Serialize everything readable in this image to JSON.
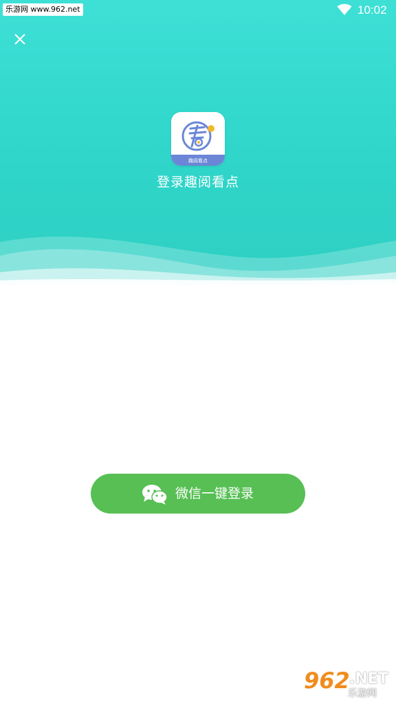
{
  "status_bar": {
    "watermark": "乐游网 www.962.net",
    "time": "10:02",
    "wifi_icon": "wifi-icon"
  },
  "header": {
    "close_icon": "close-icon",
    "logo_caption": "趣阅看点",
    "title": "登录趣阅看点"
  },
  "login": {
    "wechat_icon": "wechat-icon",
    "label": "微信一键登录"
  },
  "corner_watermark": {
    "number": "962",
    "suffix": ".NET",
    "site": "乐游网"
  },
  "colors": {
    "header_teal": "#33d8cc",
    "wechat_green": "#57bf54",
    "background": "#ffffff",
    "logo_blue": "#6b86d6"
  }
}
